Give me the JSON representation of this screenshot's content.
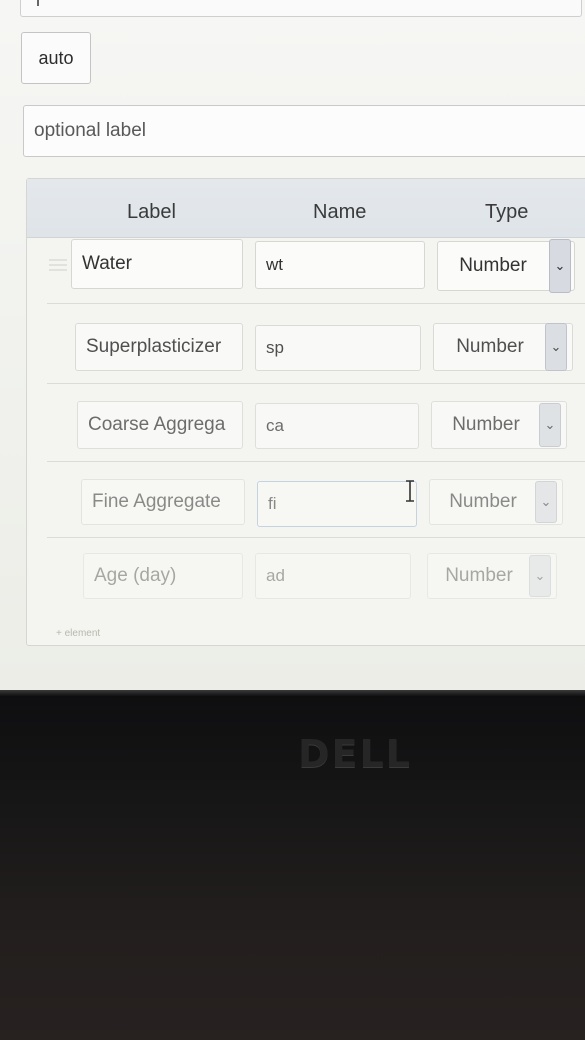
{
  "auto_button": "auto",
  "optional_label": "optional label",
  "table": {
    "headers": {
      "label": "Label",
      "name": "Name",
      "type": "Type"
    },
    "rows": [
      {
        "label": "Water",
        "name": "wt",
        "type": "Number"
      },
      {
        "label": "Superplasticizer",
        "name": "sp",
        "type": "Number"
      },
      {
        "label": "Coarse Aggrega",
        "name": "ca",
        "type": "Number"
      },
      {
        "label": "Fine Aggregate",
        "name": "fi",
        "type": "Number"
      },
      {
        "label": "Age (day)",
        "name": "ad",
        "type": "Number"
      }
    ]
  },
  "add_element": "+ element",
  "bezel_logo": "DELL",
  "icons": {
    "dropdown": "chevron-down-icon",
    "cursor": "text-cursor-icon",
    "drag": "drag-handle-icon"
  }
}
